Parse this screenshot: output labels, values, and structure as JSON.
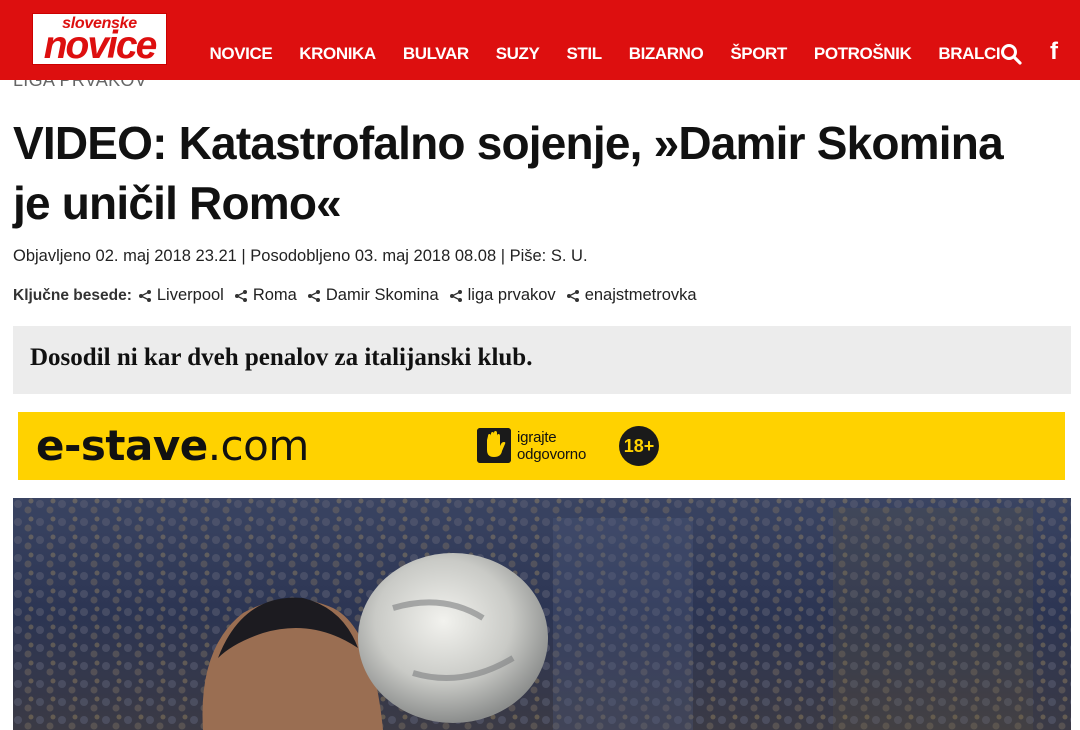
{
  "header": {
    "logo_top": "slovenske",
    "logo_main": "novice",
    "nav": [
      "NOVICE",
      "KRONIKA",
      "BULVAR",
      "SUZY",
      "STIL",
      "BIZARNO",
      "ŠPORT",
      "POTROŠNIK",
      "BRALCI"
    ],
    "search_icon": "search-icon",
    "facebook_icon": "facebook-icon",
    "facebook_glyph": "f",
    "bg_color": "#dd0f0f"
  },
  "article": {
    "section": "LIGA PRVAKOV",
    "title": "VIDEO: Katastrofalno sojenje, »Damir Skomina je uničil Romo«",
    "meta": "Objavljeno 02. maj 2018 23.21 | Posodobljeno 03. maj 2018 08.08 | Piše: S. U.",
    "keywords_label": "Ključne besede:",
    "keywords": [
      "Liverpool",
      "Roma",
      "Damir Skomina",
      "liga prvakov",
      "enajstmetrovka"
    ],
    "lead": "Dosodil ni kar dveh penalov za italijanski klub."
  },
  "ad": {
    "brand_bold": "e-stave",
    "brand_light": ".com",
    "responsible_line1": "igrajte",
    "responsible_line2": "odgovorno",
    "age": "18+",
    "bg_color": "#ffd200"
  }
}
